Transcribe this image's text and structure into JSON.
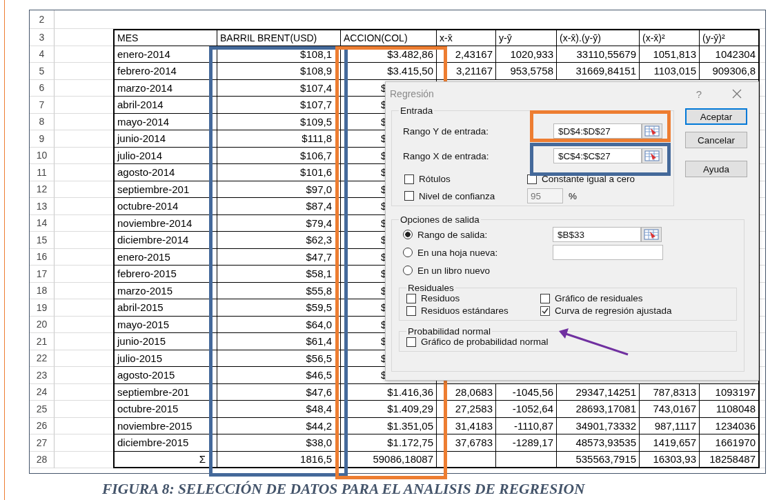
{
  "sheet": {
    "blank_row_number": "2",
    "header": {
      "number": "3",
      "columns": [
        "MES",
        "BARRIL BRENT(USD)",
        "ACCION(COL)",
        "x-x̄",
        "y-ȳ",
        "(x-x̄).(y-ȳ)",
        "(x-x̄)²",
        "(y-ȳ)²"
      ]
    },
    "rows": [
      {
        "number": "4",
        "kind": "data",
        "cells": [
          "enero-2014",
          "$108,1",
          "$3.482,86",
          "2,43167",
          "1020,933",
          "33110,55679",
          "1051,813",
          "1042304"
        ]
      },
      {
        "number": "5",
        "kind": "data",
        "cells": [
          "febrero-2014",
          "$108,9",
          "$3.415,50",
          "3,21167",
          "953,5758",
          "31669,84151",
          "1103,015",
          "909306,8"
        ]
      },
      {
        "number": "6",
        "kind": "covered",
        "cells": [
          "marzo-2014",
          "$107,4",
          "$"
        ]
      },
      {
        "number": "7",
        "kind": "covered",
        "cells": [
          "abril-2014",
          "$107,7",
          "$"
        ]
      },
      {
        "number": "8",
        "kind": "covered",
        "cells": [
          "mayo-2014",
          "$109,5",
          "$"
        ]
      },
      {
        "number": "9",
        "kind": "covered",
        "cells": [
          "junio-2014",
          "$111,8",
          "$"
        ]
      },
      {
        "number": "10",
        "kind": "covered",
        "cells": [
          "julio-2014",
          "$106,7",
          "$"
        ]
      },
      {
        "number": "11",
        "kind": "covered",
        "cells": [
          "agosto-2014",
          "$101,6",
          "$"
        ]
      },
      {
        "number": "12",
        "kind": "covered",
        "cells": [
          "septiembre-201",
          "$97,0",
          "$"
        ]
      },
      {
        "number": "13",
        "kind": "covered",
        "cells": [
          "octubre-2014",
          "$87,4",
          "$"
        ]
      },
      {
        "number": "14",
        "kind": "covered",
        "cells": [
          "noviembre-2014",
          "$79,4",
          "$"
        ]
      },
      {
        "number": "15",
        "kind": "covered",
        "cells": [
          "diciembre-2014",
          "$62,3",
          "$"
        ]
      },
      {
        "number": "16",
        "kind": "covered",
        "cells": [
          "enero-2015",
          "$47,7",
          "$"
        ]
      },
      {
        "number": "17",
        "kind": "covered",
        "cells": [
          "febrero-2015",
          "$58,1",
          "$"
        ]
      },
      {
        "number": "18",
        "kind": "covered",
        "cells": [
          "marzo-2015",
          "$55,8",
          "$"
        ]
      },
      {
        "number": "19",
        "kind": "covered",
        "cells": [
          "abril-2015",
          "$59,5",
          "$"
        ]
      },
      {
        "number": "20",
        "kind": "covered",
        "cells": [
          "mayo-2015",
          "$64,0",
          "$"
        ]
      },
      {
        "number": "21",
        "kind": "covered",
        "cells": [
          "junio-2015",
          "$61,4",
          "$"
        ]
      },
      {
        "number": "22",
        "kind": "covered",
        "cells": [
          "julio-2015",
          "$56,5",
          "$"
        ]
      },
      {
        "number": "23",
        "kind": "covered",
        "cells": [
          "agosto-2015",
          "$46,5",
          "$"
        ]
      },
      {
        "number": "24",
        "kind": "data",
        "cells": [
          "septiembre-201",
          "$47,6",
          "$1.416,36",
          "28,0683",
          "-1045,56",
          "29347,14251",
          "787,8313",
          "1093197"
        ]
      },
      {
        "number": "25",
        "kind": "data",
        "cells": [
          "octubre-2015",
          "$48,4",
          "$1.409,29",
          "27,2583",
          "-1052,64",
          "28693,17081",
          "743,0167",
          "1108048"
        ]
      },
      {
        "number": "26",
        "kind": "data",
        "cells": [
          "noviembre-2015",
          "$44,2",
          "$1.351,05",
          "31,4183",
          "-1110,87",
          "34901,73332",
          "987,1117",
          "1234036"
        ]
      },
      {
        "number": "27",
        "kind": "data",
        "cells": [
          "diciembre-2015",
          "$38,0",
          "$1.172,75",
          "37,6783",
          "-1289,17",
          "48573,93535",
          "1419,657",
          "1661970"
        ]
      },
      {
        "number": "28",
        "kind": "total",
        "cells": [
          "Σ",
          "1816,5",
          "59086,18087",
          null,
          null,
          "535563,7915",
          "16303,93",
          "18258487"
        ]
      }
    ]
  },
  "dialog": {
    "title": "Regresión",
    "help": "?",
    "input_group": {
      "label": "Entrada",
      "ranges": [
        {
          "label": "Rango Y de entrada:",
          "value": "$D$4:$D$27"
        },
        {
          "label": "Rango X de entrada:",
          "value": "$C$4:$C$27"
        }
      ],
      "checks": [
        {
          "label": "Rótulos",
          "checked": false
        },
        {
          "label": "Constante igual a cero",
          "checked": false
        },
        {
          "label": "Nivel de confianza",
          "checked": false
        }
      ],
      "confidence": {
        "value": "95",
        "unit": "%",
        "disabled": true
      }
    },
    "buttons": [
      {
        "label": "Aceptar",
        "default": true
      },
      {
        "label": "Cancelar",
        "default": false
      },
      {
        "label": "Ayuda",
        "default": false
      }
    ],
    "output_group": {
      "label": "Opciones de salida",
      "options": [
        {
          "label": "Rango de salida:",
          "selected": true,
          "kind": "range",
          "value": "$B$33"
        },
        {
          "label": "En una hoja nueva:",
          "selected": false,
          "kind": "text"
        },
        {
          "label": "En un libro nuevo",
          "selected": false,
          "kind": "none"
        }
      ],
      "residuals": {
        "label": "Residuales",
        "checks": [
          {
            "label": "Residuos",
            "checked": false
          },
          {
            "label": "Gráfico de residuales",
            "checked": false
          },
          {
            "label": "Residuos estándares",
            "checked": false
          },
          {
            "label": "Curva de regresión ajustada",
            "checked": true
          }
        ]
      },
      "normal": {
        "label": "Probabilidad normal",
        "checks": [
          {
            "label": "Gráfico de probabilidad normal",
            "checked": false
          }
        ]
      }
    }
  },
  "caption": "FIGURA 8: SELECCIÓN DE DATOS PARA EL ANALISIS DE REGRESION"
}
